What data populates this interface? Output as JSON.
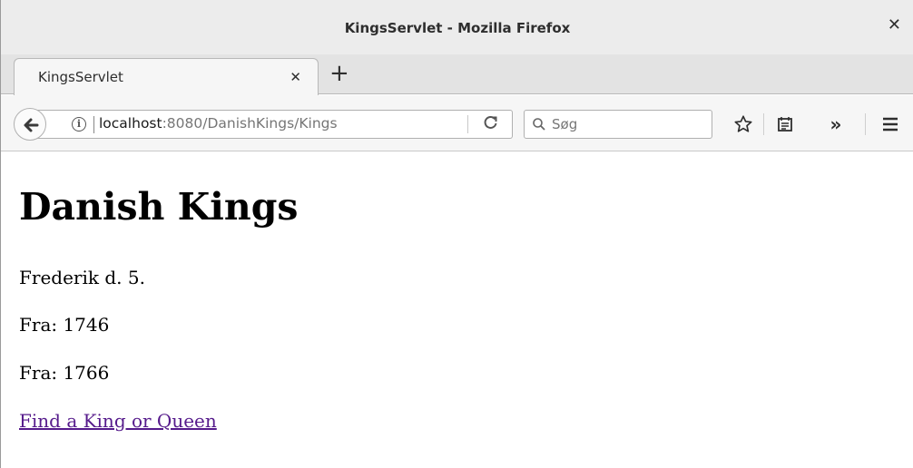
{
  "window": {
    "title": "KingsServlet - Mozilla Firefox"
  },
  "tabs": [
    {
      "label": "KingsServlet"
    }
  ],
  "new_tab_label": "+",
  "navbar": {
    "url_host": "localhost",
    "url_rest": ":8080/DanishKings/Kings",
    "search_placeholder": "Søg"
  },
  "page": {
    "heading": "Danish Kings",
    "king_name": "Frederik d. 5.",
    "from_line": "Fra: 1746",
    "to_line": "Fra: 1766",
    "link_text": "Find a King or Queen"
  },
  "colors": {
    "link_visited": "#551a8b",
    "chrome_bg": "#ececec"
  },
  "icons": [
    "close-icon",
    "back-arrow-icon",
    "info-icon",
    "reload-icon",
    "search-icon",
    "star-icon",
    "reader-view-icon",
    "overflow-chevron-icon",
    "hamburger-menu-icon"
  ]
}
